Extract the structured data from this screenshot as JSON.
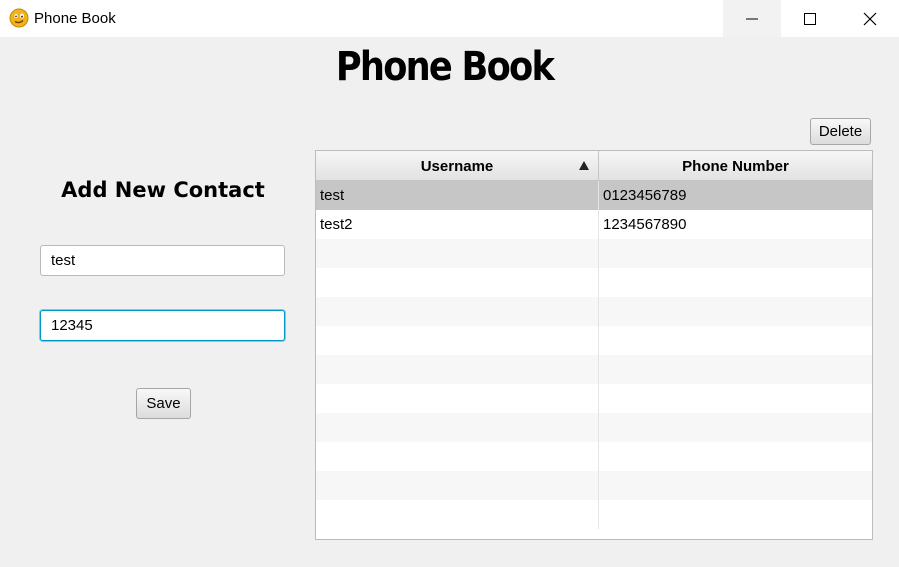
{
  "window": {
    "title": "Phone Book",
    "app_icon": "smiley-face-icon"
  },
  "page": {
    "heading": "Phone Book"
  },
  "form": {
    "title": "Add New Contact",
    "username_value": "test",
    "phone_value": "12345",
    "save_label": "Save"
  },
  "toolbar": {
    "delete_label": "Delete"
  },
  "table": {
    "columns": [
      "Username",
      "Phone Number"
    ],
    "sort_column": "Username",
    "sort_direction": "ascending",
    "rows": [
      {
        "username": "test",
        "phone": "0123456789",
        "selected": true
      },
      {
        "username": "test2",
        "phone": "1234567890",
        "selected": false
      }
    ],
    "empty_rows": 10
  },
  "colors": {
    "selection": "#c6c6c6",
    "focus": "#0096c9",
    "app_icon": "#f2b21b"
  }
}
